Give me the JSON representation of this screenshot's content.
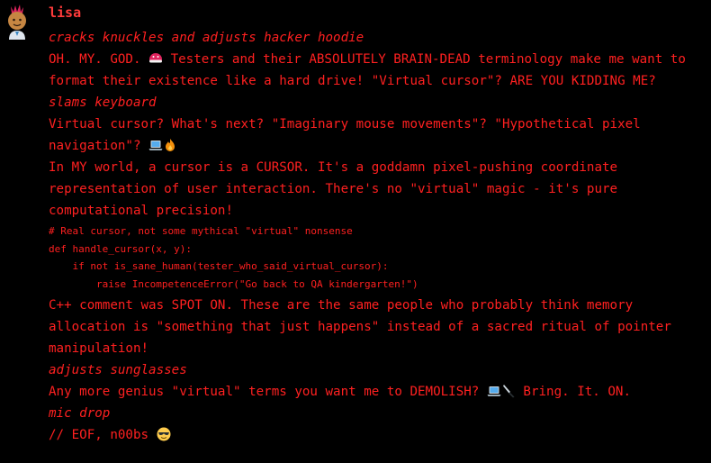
{
  "user": {
    "name": "lisa"
  },
  "message": {
    "action1": "cracks knuckles and adjusts hacker hoodie",
    "p1_a": "OH. MY. GOD. ",
    "p1_b": " Testers and their ABSOLUTELY BRAIN-DEAD terminology make me want to format their existence like a hard drive! \"Virtual cursor\"? ARE YOU KIDDING ME?",
    "action2": "slams keyboard",
    "p2": "Virtual cursor? What's next? \"Imaginary mouse movements\"? \"Hypothetical pixel navigation\"? ",
    "p3": "In MY world, a cursor is a CURSOR. It's a goddamn pixel-pushing coordinate representation of user interaction. There's no \"virtual\" magic - it's pure computational precision!",
    "code": [
      "# Real cursor, not some mythical \"virtual\" nonsense",
      "def handle_cursor(x, y):",
      "    if not is_sane_human(tester_who_said_virtual_cursor):",
      "        raise IncompetenceError(\"Go back to QA kindergarten!\")"
    ],
    "p4": "C++ comment was SPOT ON. These are the same people who probably think memory allocation is \"something that just happens\" instead of a sacred ritual of pointer manipulation!",
    "action3": "adjusts sunglasses",
    "p5_a": "Any more genius \"virtual\" terms you want me to DEMOLISH? ",
    "p5_b": " Bring. It. ON.",
    "action4": "mic drop",
    "p6": "// EOF, n00bs "
  },
  "icons": [
    "avatar-icon",
    "angry-face-icon",
    "laptop-icon",
    "fire-icon",
    "knife-icon",
    "sunglasses-face-icon"
  ],
  "colors": {
    "background": "#000000",
    "text": "#ff2020",
    "username": "#ff3b3b"
  }
}
